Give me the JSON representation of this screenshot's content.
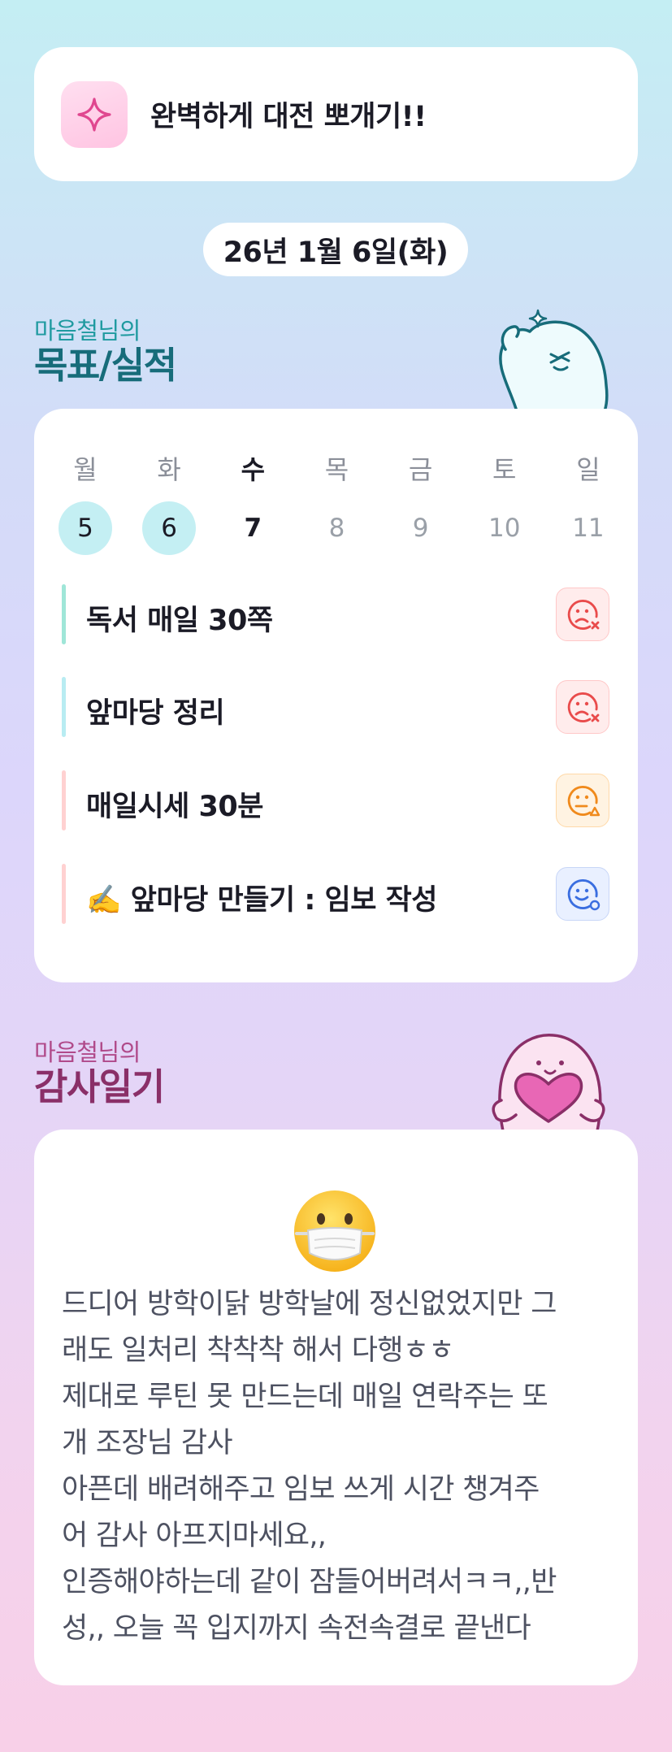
{
  "goal_banner": {
    "text": "완벽하게 대전 뽀개기!!",
    "icon": "sparkle-icon"
  },
  "date": "26년 1월 6일(화)",
  "goals_section": {
    "subtitle": "마음철님의",
    "title": "목표/실적"
  },
  "week": {
    "days": [
      {
        "label": "월",
        "num": "5",
        "state": "done"
      },
      {
        "label": "화",
        "num": "6",
        "state": "done"
      },
      {
        "label": "수",
        "num": "7",
        "state": "today"
      },
      {
        "label": "목",
        "num": "8",
        "state": "future"
      },
      {
        "label": "금",
        "num": "9",
        "state": "future"
      },
      {
        "label": "토",
        "num": "10",
        "state": "future"
      },
      {
        "label": "일",
        "num": "11",
        "state": "future"
      }
    ]
  },
  "goals": [
    {
      "name": "독서 매일 30쪽",
      "bar_color": "#9fe6d8",
      "status": "sad-x-face-icon"
    },
    {
      "name": "앞마당 정리",
      "bar_color": "#b8ecf2",
      "status": "sad-x-face-icon"
    },
    {
      "name": "매일시세 30분",
      "bar_color": "#ffd1d1",
      "status": "warning-face-icon"
    },
    {
      "name": "✍️ 앞마당 만들기 : 임보 작성",
      "bar_color": "#ffd1d1",
      "status": "smile-clock-face-icon"
    }
  ],
  "diary_section": {
    "subtitle": "마음철님의",
    "title": "감사일기"
  },
  "diary": {
    "emoji": "face-with-mask-emoji",
    "lines": [
      "드디어 방학이닭 방학날에 정신없었지만 그",
      "래도 일처리 착착착 해서 다행ㅎㅎ",
      "제대로 루틴 못 만드는데 매일 연락주는 또",
      "개 조장님 감사",
      "아픈데 배려해주고 임보 쓰게 시간 챙겨주",
      "어 감사 아프지마세요,,",
      "인증해야하는데 같이 잠들어버려서ㅋㅋ,,반",
      "성,, 오늘 꼭 입지까지 속전속결로 끝낸다"
    ]
  },
  "colors": {
    "teal": "#176c7a",
    "plum": "#8a2f68",
    "done_day": "#c4eff3"
  }
}
